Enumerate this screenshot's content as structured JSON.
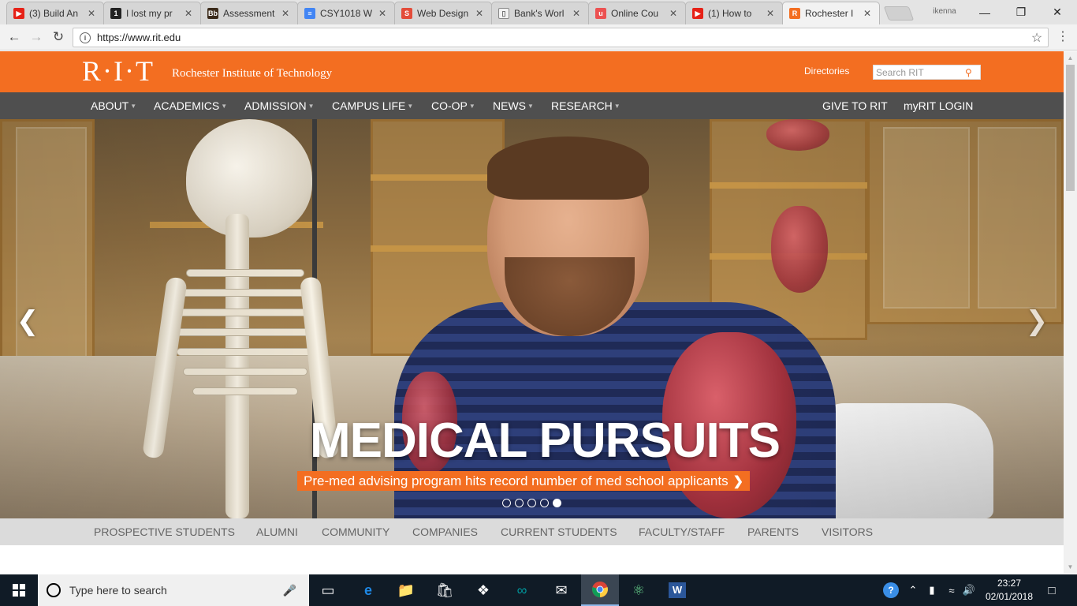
{
  "browser": {
    "tabs": [
      {
        "title": "(3) Build An",
        "favicon": "youtube-icon",
        "color": "#e62117",
        "glyph": "▶"
      },
      {
        "title": "I lost my pr",
        "favicon": "quora-icon",
        "color": "#222222",
        "glyph": "1"
      },
      {
        "title": "Assessment",
        "favicon": "blackboard-icon",
        "color": "#3b2a1a",
        "glyph": "Bb"
      },
      {
        "title": "CSY1018 W",
        "favicon": "docs-icon",
        "color": "#4285f4",
        "glyph": "≡"
      },
      {
        "title": "Web Design",
        "favicon": "slideshare-icon",
        "color": "#e34c3a",
        "glyph": "S"
      },
      {
        "title": "Bank's Worl",
        "favicon": "page-icon",
        "color": "#f2f2f2",
        "glyph": "▯"
      },
      {
        "title": "Online Cou",
        "favicon": "udemy-icon",
        "color": "#ec5252",
        "glyph": "u"
      },
      {
        "title": "(1) How to",
        "favicon": "youtube-icon",
        "color": "#e62117",
        "glyph": "▶"
      },
      {
        "title": "Rochester I",
        "favicon": "rit-icon",
        "color": "#f36e21",
        "glyph": "R",
        "active": true
      }
    ],
    "profile_name": "ikenna",
    "url": "https://www.rit.edu",
    "window_controls": {
      "minimize": "—",
      "restore": "❐",
      "close": "✕"
    }
  },
  "site": {
    "logo_mark": "R·I·T",
    "name": "Rochester Institute of Technology",
    "directories": "Directories",
    "search_placeholder": "Search RIT",
    "main_nav": [
      "ABOUT",
      "ACADEMICS",
      "ADMISSION",
      "CAMPUS LIFE",
      "CO-OP",
      "NEWS",
      "RESEARCH"
    ],
    "utility_nav": [
      "GIVE TO RIT",
      "myRIT LOGIN"
    ],
    "hero": {
      "title": "MEDICAL PURSUITS",
      "caption": "Pre-med advising program hits record number of med school applicants",
      "slide_count": 5,
      "active_slide": 5
    },
    "audience_nav": [
      "PROSPECTIVE STUDENTS",
      "ALUMNI",
      "COMMUNITY",
      "COMPANIES",
      "CURRENT STUDENTS",
      "FACULTY/STAFF",
      "PARENTS",
      "VISITORS"
    ],
    "brand_color": "#f36e21",
    "nav_color": "#4f4f4f"
  },
  "taskbar": {
    "search_placeholder": "Type here to search",
    "time": "23:27",
    "date": "02/01/2018",
    "apps": [
      "task-view-icon",
      "edge-icon",
      "file-explorer-icon",
      "store-icon",
      "dropbox-icon",
      "arduino-icon",
      "mail-icon",
      "chrome-icon",
      "atom-icon",
      "word-icon"
    ]
  }
}
